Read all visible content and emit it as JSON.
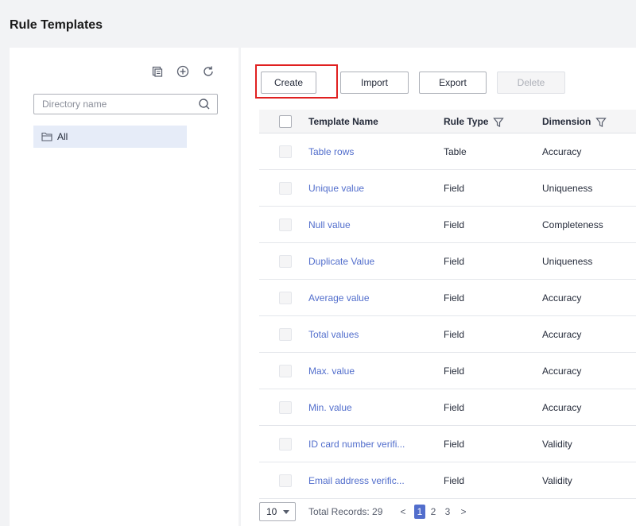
{
  "page": {
    "title": "Rule Templates"
  },
  "sidebar": {
    "toolbar_icons": [
      "new-directory-icon",
      "add-icon",
      "refresh-icon"
    ],
    "search": {
      "placeholder": "Directory name",
      "value": ""
    },
    "tree": [
      {
        "label": "All",
        "selected": true
      }
    ]
  },
  "toolbar": {
    "create_label": "Create",
    "import_label": "Import",
    "export_label": "Export",
    "delete_label": "Delete"
  },
  "table": {
    "columns": [
      "Template Name",
      "Rule Type",
      "Dimension"
    ],
    "rows": [
      {
        "name": "Table rows",
        "type": "Table",
        "dimension": "Accuracy"
      },
      {
        "name": "Unique value",
        "type": "Field",
        "dimension": "Uniqueness"
      },
      {
        "name": "Null value",
        "type": "Field",
        "dimension": "Completeness"
      },
      {
        "name": "Duplicate Value",
        "type": "Field",
        "dimension": "Uniqueness"
      },
      {
        "name": "Average value",
        "type": "Field",
        "dimension": "Accuracy"
      },
      {
        "name": "Total values",
        "type": "Field",
        "dimension": "Accuracy"
      },
      {
        "name": "Max. value",
        "type": "Field",
        "dimension": "Accuracy"
      },
      {
        "name": "Min. value",
        "type": "Field",
        "dimension": "Accuracy"
      },
      {
        "name": "ID card number verifi...",
        "type": "Field",
        "dimension": "Validity"
      },
      {
        "name": "Email address verific...",
        "type": "Field",
        "dimension": "Validity"
      }
    ]
  },
  "pagination": {
    "page_size": "10",
    "total_label": "Total Records: 29",
    "pages": [
      "1",
      "2",
      "3"
    ],
    "current_page": "1",
    "prev_symbol": "<",
    "next_symbol": ">"
  },
  "colors": {
    "link": "#526ecc",
    "highlight": "#e02020",
    "selected_tree_bg": "#e6ecf8"
  }
}
